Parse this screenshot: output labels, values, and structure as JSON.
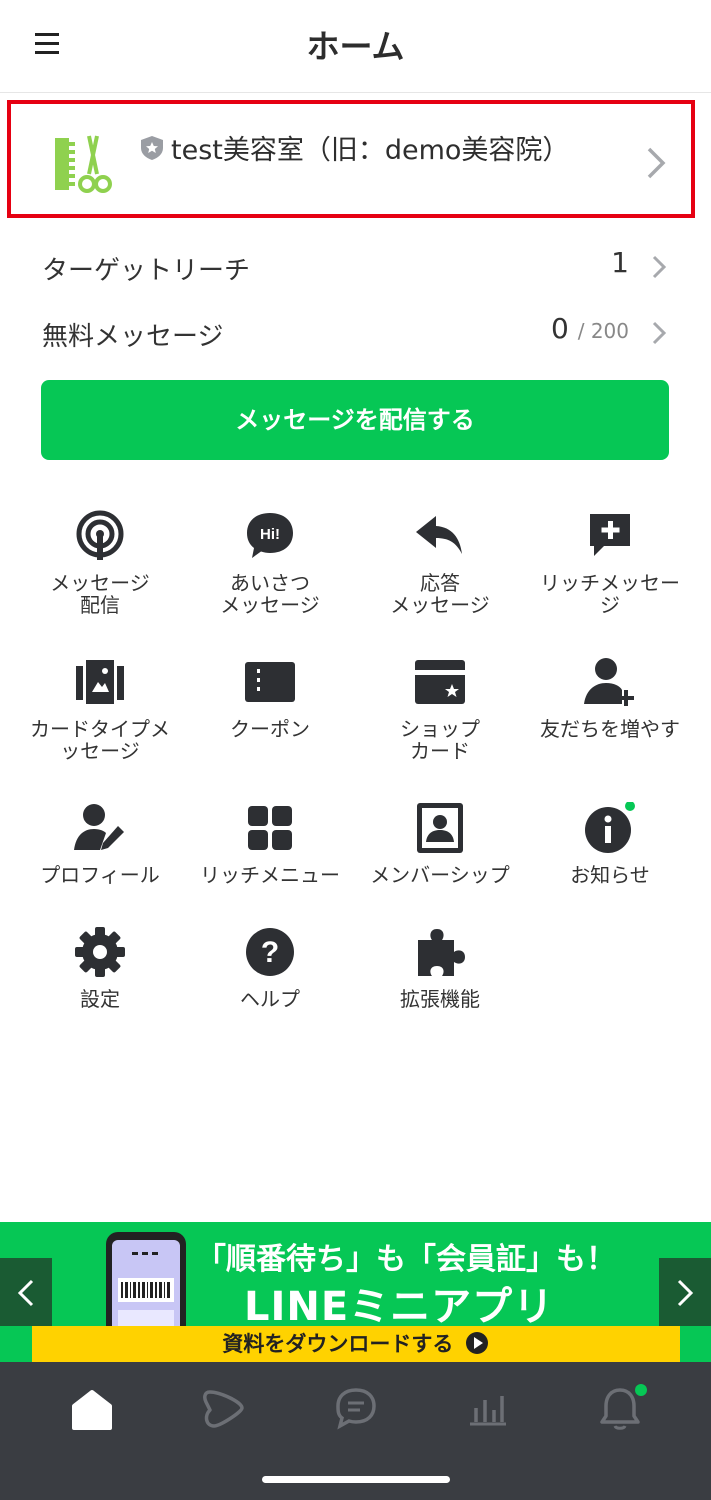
{
  "header": {
    "title": "ホーム",
    "menu_icon": "hamburger-menu-icon"
  },
  "account": {
    "name": "test美容室（旧：demo美容院）",
    "logo_icon": "comb-scissors-icon",
    "badge_icon": "shield-star-icon"
  },
  "stats": {
    "target_reach": {
      "label": "ターゲットリーチ",
      "value": "1"
    },
    "free_messages": {
      "label": "無料メッセージ",
      "value": "0",
      "limit": "/ 200"
    }
  },
  "send_button": {
    "label": "メッセージを配信する"
  },
  "menu": [
    {
      "label": "メッセージ\n配信",
      "icon": "broadcast-icon"
    },
    {
      "label": "あいさつ\nメッセージ",
      "icon": "hi-bubble-icon"
    },
    {
      "label": "応答\nメッセージ",
      "icon": "reply-arrow-icon"
    },
    {
      "label": "リッチメッセー\nジ",
      "icon": "plus-bubble-icon"
    },
    {
      "label": "カードタイプメ\nッセージ",
      "icon": "card-stack-icon"
    },
    {
      "label": "クーポン",
      "icon": "coupon-icon"
    },
    {
      "label": "ショップ\nカード",
      "icon": "shop-card-icon"
    },
    {
      "label": "友だちを増やす",
      "icon": "add-friend-icon"
    },
    {
      "label": "プロフィール",
      "icon": "profile-edit-icon"
    },
    {
      "label": "リッチメニュー",
      "icon": "grid-icon"
    },
    {
      "label": "メンバーシップ",
      "icon": "member-icon"
    },
    {
      "label": "お知らせ",
      "icon": "info-icon"
    },
    {
      "label": "設定",
      "icon": "gear-icon"
    },
    {
      "label": "ヘルプ",
      "icon": "help-icon"
    },
    {
      "label": "拡張機能",
      "icon": "puzzle-icon"
    }
  ],
  "banner": {
    "headline": "「順番待ち」も「会員証」も！",
    "brand": "LINEミニアプリ",
    "cta": "資料をダウンロードする"
  },
  "tabbar": [
    {
      "icon": "home-icon",
      "active": true
    },
    {
      "icon": "voom-icon",
      "active": false
    },
    {
      "icon": "chat-icon",
      "active": false
    },
    {
      "icon": "analytics-icon",
      "active": false
    },
    {
      "icon": "bell-icon",
      "active": false
    }
  ],
  "colors": {
    "brand_green": "#06c755",
    "highlight_red": "#e60012",
    "icon_dark": "#2d2f33",
    "tabbar_bg": "#3a3d42"
  }
}
